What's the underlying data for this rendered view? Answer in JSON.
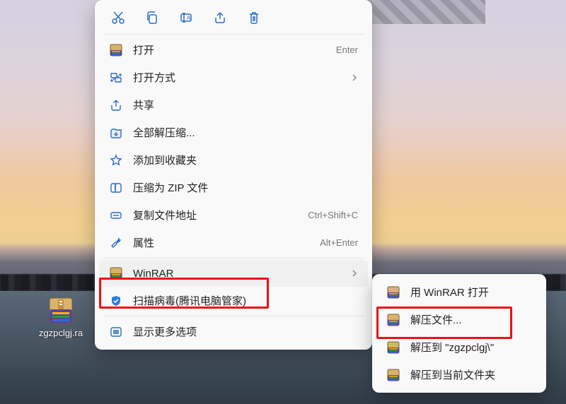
{
  "desktop": {
    "file_label": "zgzpclgj.ra"
  },
  "menu": {
    "open_label": "打开",
    "open_shortcut": "Enter",
    "open_with_label": "打开方式",
    "share_label": "共享",
    "extract_all_label": "全部解压缩...",
    "favorite_label": "添加到收藏夹",
    "compress_zip_label": "压缩为 ZIP 文件",
    "copy_path_label": "复制文件地址",
    "copy_path_shortcut": "Ctrl+Shift+C",
    "properties_label": "属性",
    "properties_shortcut": "Alt+Enter",
    "winrar_label": "WinRAR",
    "scan_label": "扫描病毒(腾讯电脑管家)",
    "more_label": "显示更多选项"
  },
  "submenu": {
    "open_with_winrar_label": "用 WinRAR 打开",
    "extract_files_label": "解压文件...",
    "extract_to_label": "解压到 \"zgzpclgj\\\"",
    "extract_here_label": "解压到当前文件夹"
  }
}
